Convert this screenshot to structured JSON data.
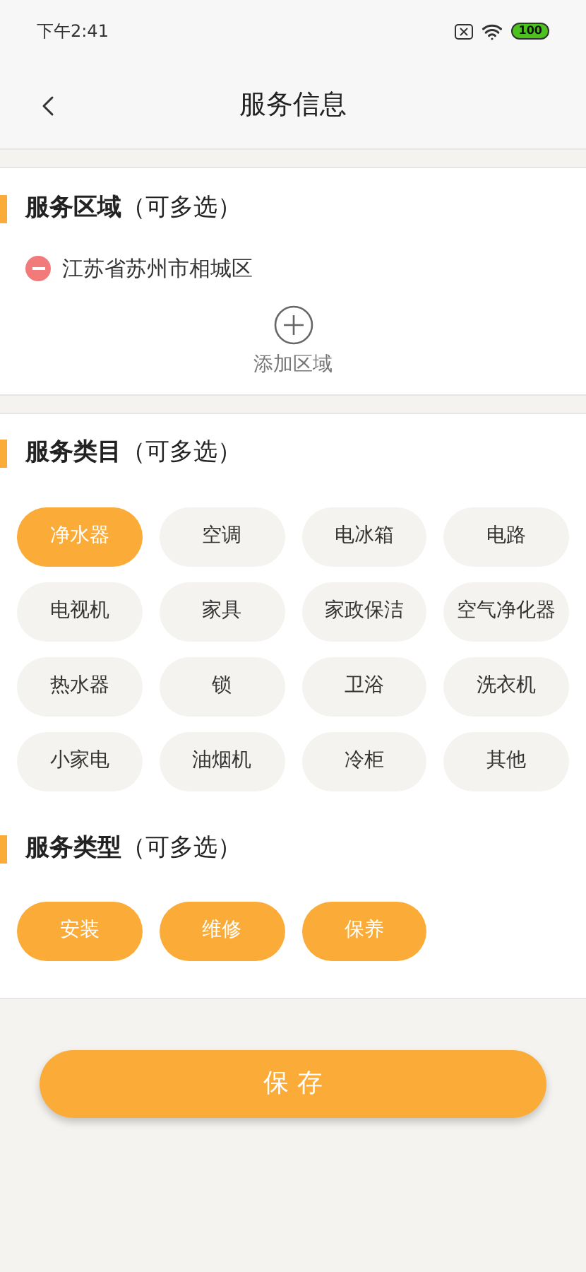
{
  "status_bar": {
    "time": "下午2:41",
    "battery": "100"
  },
  "header": {
    "title": "服务信息"
  },
  "area_section": {
    "title": "**服务区域**（可多选）",
    "areas": [
      "江苏省苏州市相城区"
    ],
    "add_label": "添加区域"
  },
  "category_section": {
    "title": "**服务类目**（可多选）",
    "items": [
      {
        "label": "净水器",
        "selected": true
      },
      {
        "label": "空调",
        "selected": false
      },
      {
        "label": "电冰箱",
        "selected": false
      },
      {
        "label": "电路",
        "selected": false
      },
      {
        "label": "电视机",
        "selected": false
      },
      {
        "label": "家具",
        "selected": false
      },
      {
        "label": "家政保洁",
        "selected": false
      },
      {
        "label": "空气净化器",
        "selected": false
      },
      {
        "label": "热水器",
        "selected": false
      },
      {
        "label": "锁",
        "selected": false
      },
      {
        "label": "卫浴",
        "selected": false
      },
      {
        "label": "洗衣机",
        "selected": false
      },
      {
        "label": "小家电",
        "selected": false
      },
      {
        "label": "油烟机",
        "selected": false
      },
      {
        "label": "冷柜",
        "selected": false
      },
      {
        "label": "其他",
        "selected": false
      }
    ]
  },
  "type_section": {
    "title": "**服务类型**（可多选）",
    "items": [
      {
        "label": "安装",
        "selected": true
      },
      {
        "label": "维修",
        "selected": true
      },
      {
        "label": "保养",
        "selected": true
      }
    ]
  },
  "save_button": "保 存"
}
